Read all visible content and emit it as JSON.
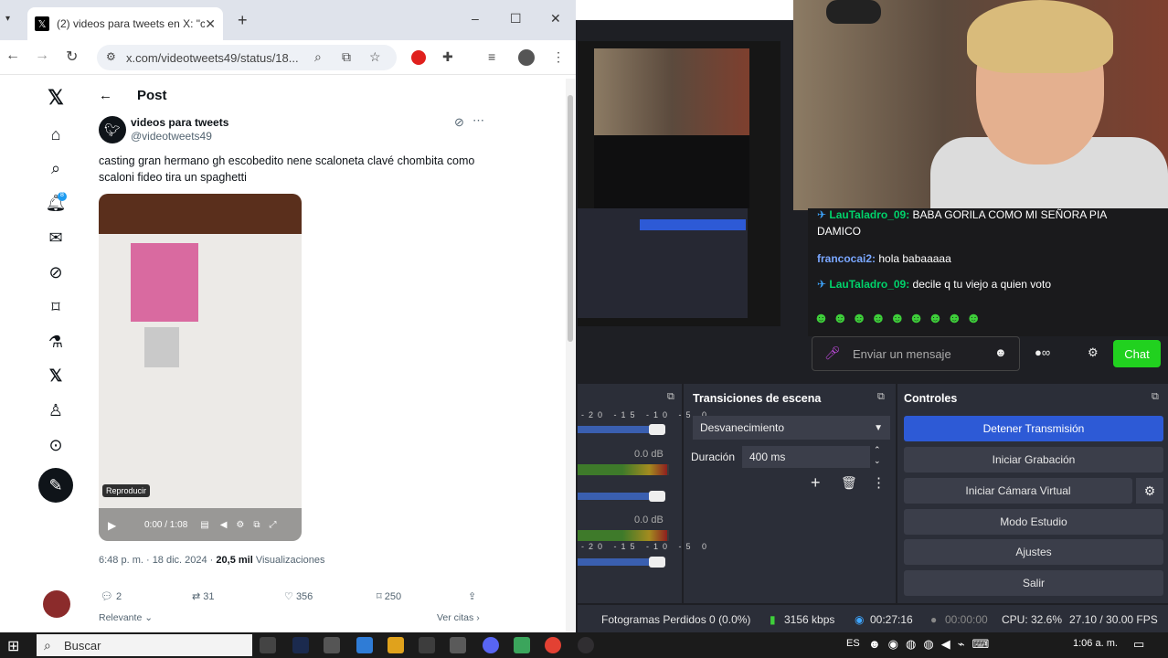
{
  "browser": {
    "tab_title": "(2) videos para tweets en X: \"ca",
    "url": "x.com/videotweets49/status/18...",
    "window_min": "–",
    "window_max": "☐",
    "window_close": "✕"
  },
  "x": {
    "header_title": "Post",
    "nav_badge": "8",
    "user_name": "videos para tweets",
    "user_handle": "@videotweets49",
    "post_text": "casting gran hermano gh escobedito nene scaloneta clavé chombita como scaloni fideo tira un spaghetti",
    "video_tooltip": "Reproducir",
    "video_time": "0:00 / 1:08",
    "meta_date": "6:48 p. m. · 18 dic. 2024 · ",
    "meta_views_count": "20,5 mil",
    "meta_views_label": " Visualizaciones",
    "replies": "2",
    "reposts": "31",
    "likes": "356",
    "bookmarks": "250",
    "relevant": "Relevante",
    "quotes": "Ver citas"
  },
  "twitch_chat": {
    "messages": [
      {
        "user": "LauTaladro_09:",
        "text": " BABA GORILA COMO MI SEÑORA PIA"
      },
      {
        "user": "",
        "text": "DAMICO"
      },
      {
        "user": "francocai2:",
        "text": " hola babaaaaa"
      },
      {
        "user": "LauTaladro_09:",
        "text": " decile q tu viejo a quien voto"
      }
    ],
    "input_placeholder": "Enviar un mensaje",
    "chat_button": "Chat"
  },
  "obs": {
    "transitions_title": "Transiciones de escena",
    "controls_title": "Controles",
    "transition_select": "Desvanecimiento",
    "duration_label": "Duración",
    "duration_value": "400 ms",
    "buttons": [
      "Detener Transmisión",
      "Iniciar Grabación",
      "Iniciar Cámara Virtual",
      "Modo Estudio",
      "Ajustes",
      "Salir"
    ],
    "meter_scale": "-20 -15 -10 -5 0",
    "meter_db": "0.0 dB",
    "status": {
      "dropped": "Fotogramas Perdidos 0 (0.0%)",
      "bitrate": "3156 kbps",
      "live_time": "00:27:16",
      "rec_time": "00:00:00",
      "cpu": "CPU: 32.6%",
      "fps": "27.10 / 30.00 FPS"
    }
  },
  "taskbar": {
    "search": "Buscar",
    "lang": "ES",
    "clock": "1:06 a. m."
  }
}
